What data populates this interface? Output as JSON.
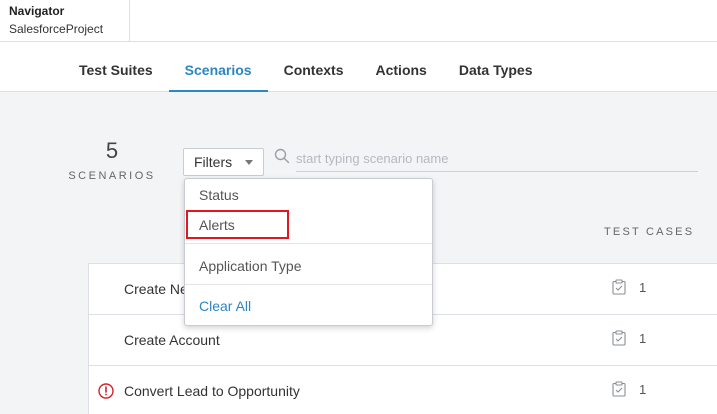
{
  "navigator": {
    "title": "Navigator",
    "project": "SalesforceProject"
  },
  "tabs": [
    {
      "label": "Test Suites",
      "active": false
    },
    {
      "label": "Scenarios",
      "active": true
    },
    {
      "label": "Contexts",
      "active": false
    },
    {
      "label": "Actions",
      "active": false
    },
    {
      "label": "Data Types",
      "active": false
    }
  ],
  "summary": {
    "count": "5",
    "label": "SCENARIOS"
  },
  "filters": {
    "button_label": "Filters",
    "menu": {
      "status": "Status",
      "alerts": "Alerts",
      "application_type": "Application Type",
      "clear_all": "Clear All"
    }
  },
  "search": {
    "placeholder": "start typing scenario name",
    "value": ""
  },
  "columns": {
    "test_cases": "TEST CASES"
  },
  "scenarios": [
    {
      "name": "Create New",
      "test_cases": "1",
      "alert": false
    },
    {
      "name": "Create Account",
      "test_cases": "1",
      "alert": false
    },
    {
      "name": "Convert Lead to Opportunity",
      "test_cases": "1",
      "alert": true
    }
  ],
  "colors": {
    "accent": "#2d86c4",
    "alert": "#d0232b",
    "highlight": "#e2161e"
  },
  "icons": {
    "search": "search-icon",
    "caret": "caret-down-icon",
    "clipboard": "clipboard-check-icon",
    "alert": "alert-circle-icon"
  }
}
